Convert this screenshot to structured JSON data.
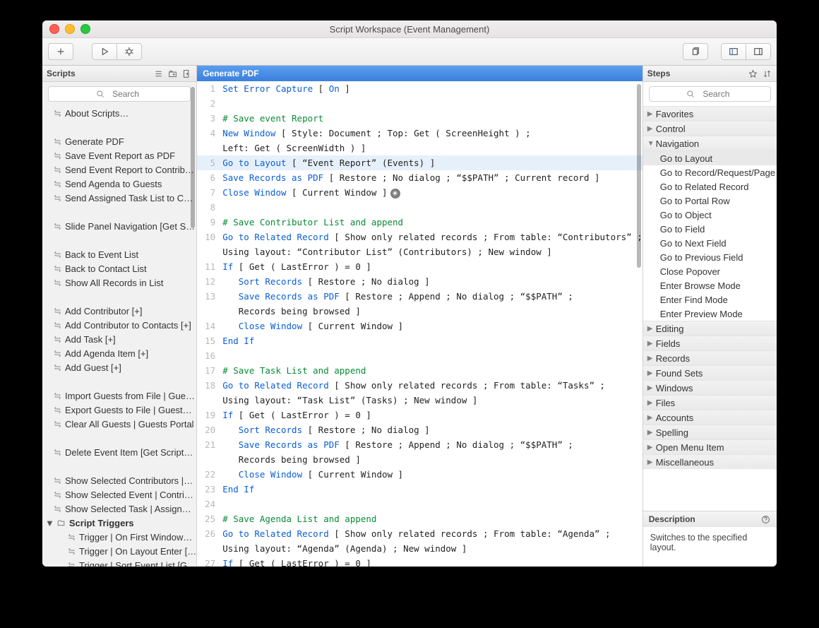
{
  "window_title": "Script Workspace (Event Management)",
  "scripts_panel": {
    "title": "Scripts",
    "search_placeholder": "Search",
    "items": [
      "About Scripts…",
      "",
      "Generate PDF",
      "Save Event Report as PDF",
      "Send Event Report to Contrib…",
      "Send Agenda to Guests",
      "Send Assigned Task List to C…",
      "",
      "Slide Panel Navigation [Get S…",
      "",
      "Back to Event List",
      "Back to Contact List",
      "Show All Records in List",
      "",
      "Add Contributor [+]",
      "Add Contributor to Contacts [+]",
      "Add Task [+]",
      "Add Agenda Item [+]",
      "Add Guest [+]",
      "",
      "Import Guests from File | Gue…",
      "Export Guests to File | Guest…",
      "Clear All Guests | Guests Portal",
      "",
      "Delete Event Item [Get Script…",
      "",
      "Show Selected Contributors |…",
      "Show Selected Event | Contri…",
      "Show Selected Task  | Assign…"
    ],
    "folder": {
      "label": "Script Triggers",
      "children": [
        "Trigger | On First Window…",
        "Trigger | On Layout Enter […",
        "Trigger | Sort Event List [G…"
      ]
    }
  },
  "editor": {
    "title": "Generate PDF",
    "lines": [
      {
        "n": 1,
        "h": [
          [
            "Set Error Capture",
            "b"
          ],
          [
            " [ ",
            "p"
          ],
          [
            "On",
            "b"
          ],
          [
            " ]",
            "p"
          ]
        ]
      },
      {
        "n": 2,
        "h": []
      },
      {
        "n": 3,
        "h": [
          [
            "# Save event Report",
            "g"
          ]
        ]
      },
      {
        "n": 4,
        "h": [
          [
            "New Window",
            "b"
          ],
          [
            " [ Style: Document ; Top: Get ( ScreenHeight ) ;",
            "p"
          ]
        ],
        "cont": "Left: Get ( ScreenWidth ) ]"
      },
      {
        "n": 5,
        "sel": true,
        "h": [
          [
            "Go to Layout",
            "b"
          ],
          [
            " [ “Event Report” (Events) ]",
            "p"
          ]
        ]
      },
      {
        "n": 6,
        "h": [
          [
            "Save Records as PDF",
            "b"
          ],
          [
            " [ Restore ; No dialog ; “$$PATH” ; Current record ]",
            "p"
          ]
        ]
      },
      {
        "n": 7,
        "h": [
          [
            "Close Window",
            "b"
          ],
          [
            " [ Current Window ]",
            "p"
          ]
        ],
        "gear": true
      },
      {
        "n": 8,
        "h": []
      },
      {
        "n": 9,
        "h": [
          [
            "# Save Contributor List and append",
            "g"
          ]
        ]
      },
      {
        "n": 10,
        "h": [
          [
            "Go to Related Record",
            "b"
          ],
          [
            " [ Show only related records ; From table: “Contributors” ;",
            "p"
          ]
        ],
        "cont": "Using layout: “Contributor List” (Contributors) ; New window ]"
      },
      {
        "n": 11,
        "h": [
          [
            "If",
            "b"
          ],
          [
            " [ Get ( LastError ) = 0 ]",
            "p"
          ]
        ]
      },
      {
        "n": 12,
        "h": [
          [
            "   ",
            "p"
          ],
          [
            "Sort Records",
            "b"
          ],
          [
            " [ Restore ; No dialog ]",
            "p"
          ]
        ]
      },
      {
        "n": 13,
        "h": [
          [
            "   ",
            "p"
          ],
          [
            "Save Records as PDF",
            "b"
          ],
          [
            " [ Restore ; Append ; No dialog ; “$$PATH” ;",
            "p"
          ]
        ],
        "cont": "   Records being browsed ]"
      },
      {
        "n": 14,
        "h": [
          [
            "   ",
            "p"
          ],
          [
            "Close Window",
            "b"
          ],
          [
            " [ Current Window ]",
            "p"
          ]
        ]
      },
      {
        "n": 15,
        "h": [
          [
            "End If",
            "b"
          ]
        ]
      },
      {
        "n": 16,
        "h": []
      },
      {
        "n": 17,
        "h": [
          [
            "# Save Task List and append",
            "g"
          ]
        ]
      },
      {
        "n": 18,
        "h": [
          [
            "Go to Related Record",
            "b"
          ],
          [
            " [ Show only related records ; From table: “Tasks” ;",
            "p"
          ]
        ],
        "cont": "Using layout: “Task List” (Tasks) ; New window ]"
      },
      {
        "n": 19,
        "h": [
          [
            "If",
            "b"
          ],
          [
            " [ Get ( LastError ) = 0 ]",
            "p"
          ]
        ]
      },
      {
        "n": 20,
        "h": [
          [
            "   ",
            "p"
          ],
          [
            "Sort Records",
            "b"
          ],
          [
            " [ Restore ; No dialog ]",
            "p"
          ]
        ]
      },
      {
        "n": 21,
        "h": [
          [
            "   ",
            "p"
          ],
          [
            "Save Records as PDF",
            "b"
          ],
          [
            " [ Restore ; Append ; No dialog ; “$$PATH” ;",
            "p"
          ]
        ],
        "cont": "   Records being browsed ]"
      },
      {
        "n": 22,
        "h": [
          [
            "   ",
            "p"
          ],
          [
            "Close Window",
            "b"
          ],
          [
            " [ Current Window ]",
            "p"
          ]
        ]
      },
      {
        "n": 23,
        "h": [
          [
            "End If",
            "b"
          ]
        ]
      },
      {
        "n": 24,
        "h": []
      },
      {
        "n": 25,
        "h": [
          [
            "# Save Agenda List and append",
            "g"
          ]
        ]
      },
      {
        "n": 26,
        "h": [
          [
            "Go to Related Record",
            "b"
          ],
          [
            " [ Show only related records ; From table: “Agenda” ;",
            "p"
          ]
        ],
        "cont": "Using layout: “Agenda” (Agenda) ; New window ]"
      },
      {
        "n": 27,
        "h": [
          [
            "If",
            "b"
          ],
          [
            " [ Get ( LastError ) = 0 ]",
            "p"
          ]
        ]
      }
    ]
  },
  "steps_panel": {
    "title": "Steps",
    "search_placeholder": "Search",
    "categories": [
      {
        "name": "Favorites",
        "open": false
      },
      {
        "name": "Control",
        "open": false
      },
      {
        "name": "Navigation",
        "open": true,
        "items": [
          "Go to Layout",
          "Go to Record/Request/Page",
          "Go to Related Record",
          "Go to Portal Row",
          "Go to Object",
          "Go to Field",
          "Go to Next Field",
          "Go to Previous Field",
          "Close Popover",
          "Enter Browse Mode",
          "Enter Find Mode",
          "Enter Preview Mode"
        ],
        "selected": "Go to Layout"
      },
      {
        "name": "Editing",
        "open": false
      },
      {
        "name": "Fields",
        "open": false
      },
      {
        "name": "Records",
        "open": false
      },
      {
        "name": "Found Sets",
        "open": false
      },
      {
        "name": "Windows",
        "open": false
      },
      {
        "name": "Files",
        "open": false
      },
      {
        "name": "Accounts",
        "open": false
      },
      {
        "name": "Spelling",
        "open": false
      },
      {
        "name": "Open Menu Item",
        "open": false
      },
      {
        "name": "Miscellaneous",
        "open": false
      }
    ]
  },
  "description": {
    "title": "Description",
    "text": "Switches to the specified layout."
  }
}
